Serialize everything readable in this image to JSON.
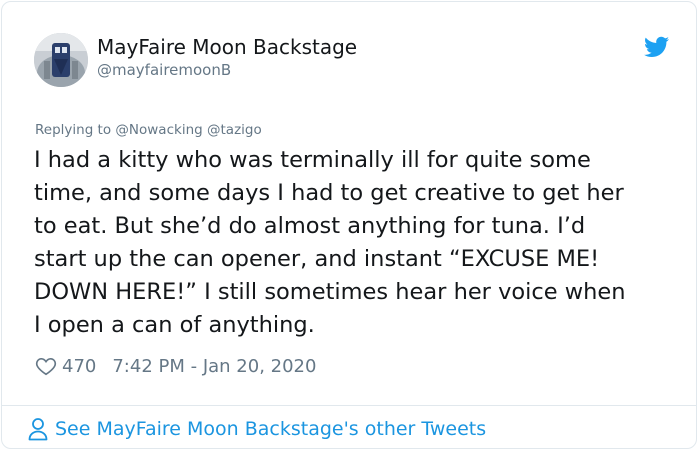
{
  "author": {
    "display_name": "MayFaire Moon Backstage",
    "handle": "@mayfairemoonB",
    "avatar": "avatar-photo"
  },
  "reply_context": {
    "prefix": "Replying to",
    "mentions": [
      "@Nowacking",
      "@tazigo"
    ]
  },
  "tweet": {
    "lines": [
      "I had a kitty who was terminally ill for quite some",
      "time, and some days I had to get creative to get her",
      "to eat. But she’d do almost anything for tuna. I’d",
      "start up the can opener, and instant “EXCUSE ME!",
      "DOWN HERE!” I still sometimes hear her voice when",
      "I open a can of anything."
    ],
    "like_count": "470",
    "timestamp": "7:42 PM - Jan 20, 2020"
  },
  "footer": {
    "link_text": "See MayFaire Moon Backstage's other Tweets",
    "icon": "person-icon"
  },
  "colors": {
    "brand_blue": "#1DA1F2",
    "link_blue": "#1B95E0",
    "muted_gray": "#657786",
    "text": "#14171A",
    "border": "#E1E8ED"
  },
  "icons": [
    "twitter-bird-icon",
    "heart-icon",
    "person-icon"
  ]
}
